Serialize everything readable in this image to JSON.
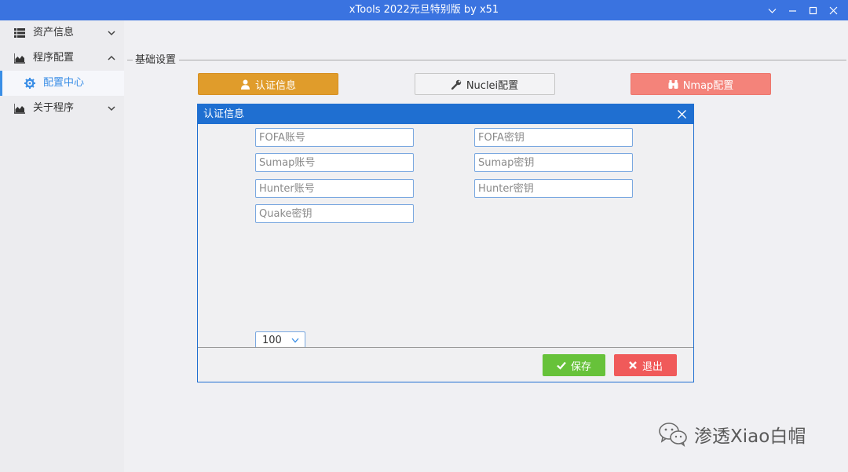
{
  "window": {
    "title": "xTools  2022元旦特别版   by x51"
  },
  "sidebar": {
    "items": [
      {
        "label": "资产信息",
        "icon": "list-icon",
        "expanded": false
      },
      {
        "label": "程序配置",
        "icon": "area-chart-icon",
        "expanded": true
      },
      {
        "label": "配置中心",
        "icon": "gear-icon",
        "active": true
      },
      {
        "label": "关于程序",
        "icon": "area-chart-icon",
        "expanded": false
      }
    ]
  },
  "main": {
    "group_title": "基础设置",
    "buttons": {
      "auth": "认证信息",
      "nuclei": "Nuclei配置",
      "nmap": "Nmap配置"
    }
  },
  "dialog": {
    "title": "认证信息",
    "fields": {
      "fofa_account": "FOFA账号",
      "fofa_key": "FOFA密钥",
      "sumap_account": "Sumap账号",
      "sumap_key": "Sumap密钥",
      "hunter_account": "Hunter账号",
      "hunter_key": "Hunter密钥",
      "quake_key": "Quake密钥"
    },
    "page_size": "100",
    "save_label": "保存",
    "exit_label": "退出"
  },
  "watermark": {
    "text": "渗透Xiao白帽"
  },
  "colors": {
    "titlebar": "#3a73e0",
    "dialog_header": "#1f6fd1",
    "auth_button": "#e09c2b",
    "nmap_button": "#f4837a",
    "save_button": "#67c23a",
    "exit_button": "#f05a5a",
    "active_nav": "#3a8ee6"
  }
}
